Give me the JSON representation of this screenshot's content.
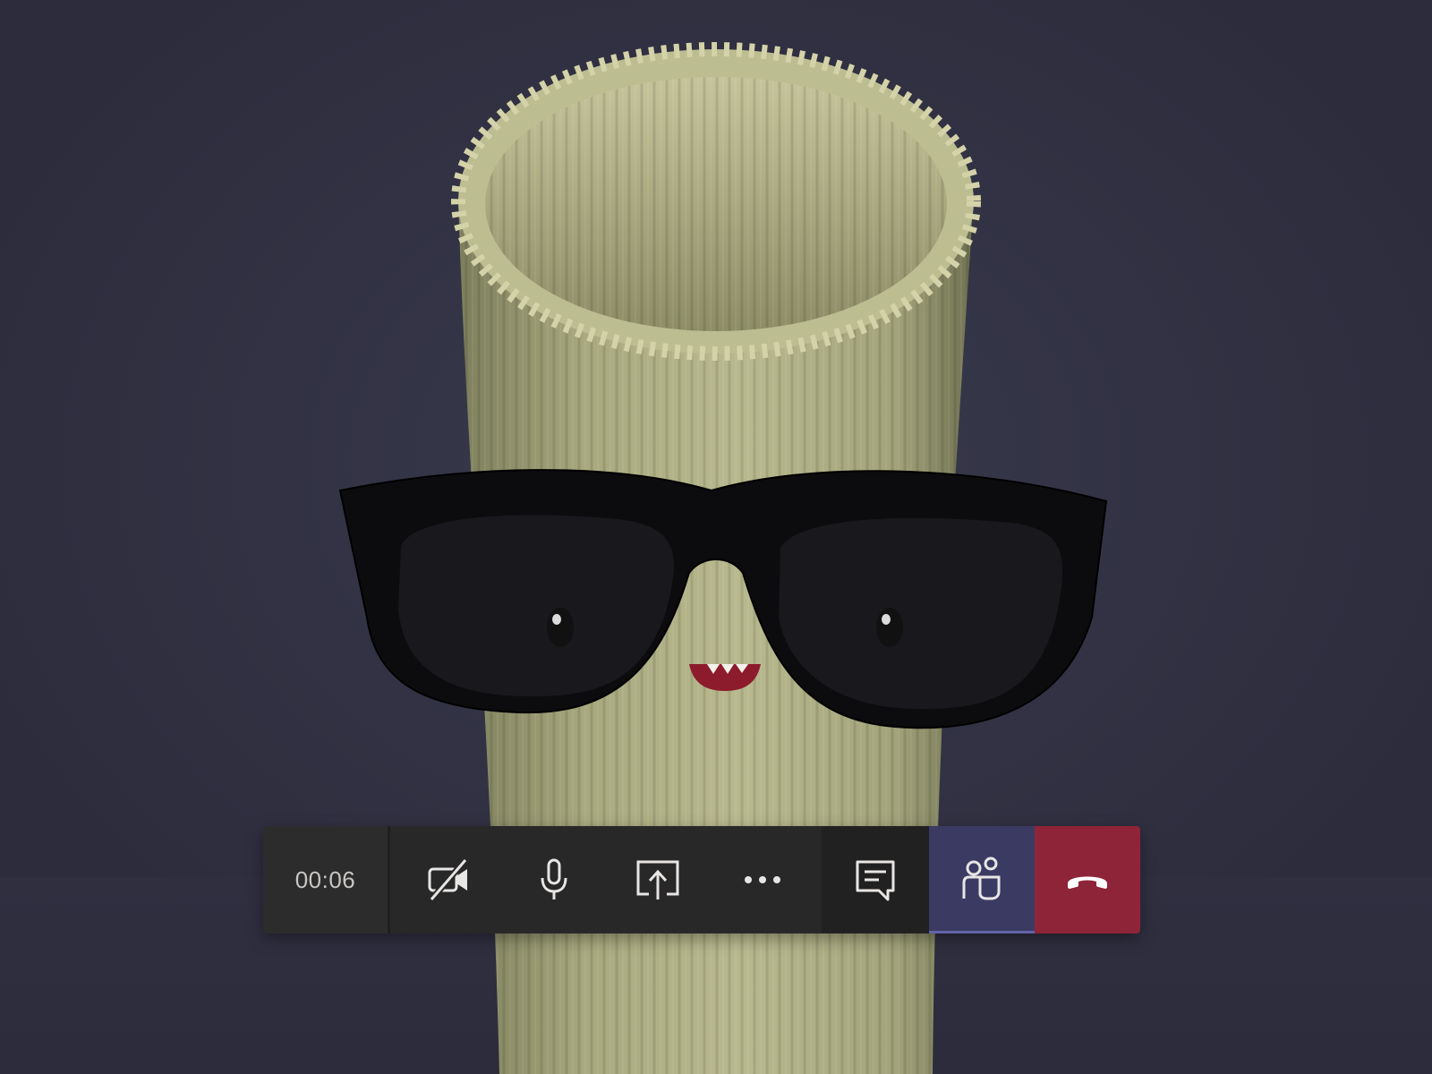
{
  "call": {
    "duration": "00:06"
  },
  "controls": {
    "camera": {
      "icon": "camera-off-icon",
      "state": "off"
    },
    "microphone": {
      "icon": "microphone-icon",
      "state": "on"
    },
    "share": {
      "icon": "share-screen-icon"
    },
    "more": {
      "icon": "more-options-icon"
    },
    "chat": {
      "icon": "chat-icon"
    },
    "participants": {
      "icon": "participants-icon"
    },
    "hangup": {
      "icon": "hang-up-icon"
    }
  },
  "colors": {
    "background": "#323244",
    "bar_dark": "#292828",
    "participants_accent": "#3b3a63",
    "hangup_red": "#8e2438",
    "icon": "#e8e6e4"
  }
}
